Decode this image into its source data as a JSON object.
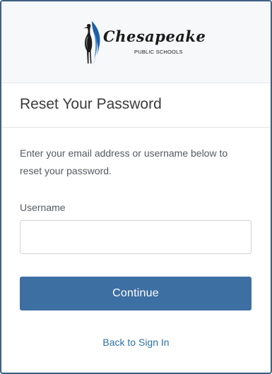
{
  "header": {
    "logo": {
      "wordmark": "Chesapeake",
      "subtext": "PUBLIC SCHOOLS",
      "icon": "heron-icon",
      "colors": {
        "blue": "#1f5fa8",
        "dark": "#1b1b1b"
      }
    }
  },
  "form": {
    "title": "Reset Your Password",
    "instructions": "Enter your email address or username below to reset your password.",
    "username_label": "Username",
    "username_value": "",
    "username_placeholder": "",
    "continue_label": "Continue",
    "back_link_label": "Back to Sign In"
  },
  "colors": {
    "primary_button": "#3e6fa3",
    "link": "#2a72a6",
    "frame_border": "#3d5f85"
  }
}
